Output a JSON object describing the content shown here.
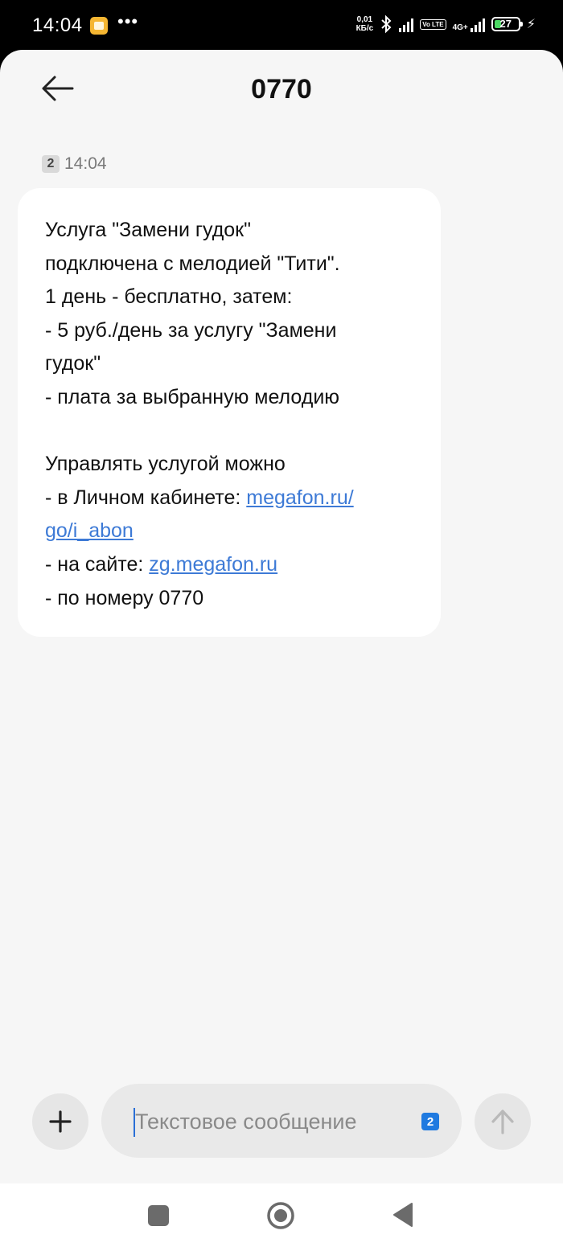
{
  "status_bar": {
    "time": "14:04",
    "more": "•••",
    "net_speed_value": "0,01",
    "net_speed_unit": "КБ/с",
    "volte": "Vo LTE",
    "network": "4G+",
    "battery": "27",
    "battery_level": 0.27,
    "icons": [
      "notification-app-icon",
      "bluetooth-icon",
      "signal-icon",
      "volte-icon",
      "signal-4g-icon",
      "battery-icon",
      "charging-icon"
    ]
  },
  "header": {
    "title": "0770",
    "back_icon": "back-arrow-icon"
  },
  "message": {
    "sim": "2",
    "time": "14:04",
    "lines": [
      "Услуга \"Замени гудок\"",
      "подключена с мелодией \"Тити\".",
      "1 день - бесплатно, затем:",
      "- 5 руб./день за услугу \"Замени",
      "гудок\"",
      "- плата за выбранную мелодию",
      "",
      "Управлять услугой можно",
      "- в Личном кабинете: ",
      "megafon.ru/",
      "go/i_abon",
      "- на сайте: ",
      "zg.megafon.ru",
      "- по номеру 0770"
    ]
  },
  "composer": {
    "placeholder": "Текстовое сообщение",
    "sim": "2",
    "attach_icon": "plus-icon",
    "send_icon": "send-arrow-icon"
  },
  "navbar": {
    "icons": [
      "recents-icon",
      "home-icon",
      "back-icon"
    ]
  },
  "colors": {
    "link": "#3d7ad6",
    "accent": "#1f7ae0",
    "battery_fill": "#4cd964",
    "background": "#f6f6f6"
  }
}
